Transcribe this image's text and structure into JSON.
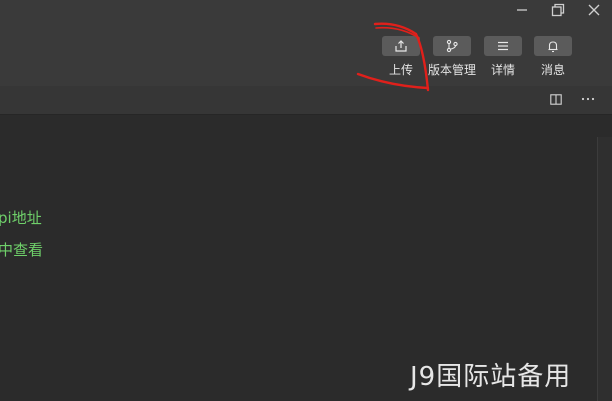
{
  "toolbar": {
    "actions": [
      {
        "label": "上传",
        "icon": "upload-icon"
      },
      {
        "label": "版本管理",
        "icon": "branch-icon"
      },
      {
        "label": "详情",
        "icon": "list-icon"
      },
      {
        "label": "消息",
        "icon": "bell-icon"
      }
    ]
  },
  "window_controls": {
    "minimize_icon": "minimize-icon",
    "restore_icon": "restore-icon",
    "close_icon": "close-icon"
  },
  "subbar": {
    "icons": [
      "split-view-icon",
      "more-icon"
    ]
  },
  "content": {
    "lines": [
      "pi地址",
      "中查看"
    ]
  },
  "watermark": {
    "text": "J9国际站备用"
  },
  "colors": {
    "titlebar": "#3a3a3a",
    "editor_bg": "#2b2b2b",
    "code_text": "#6fd06a",
    "annotation": "#e0201b"
  }
}
